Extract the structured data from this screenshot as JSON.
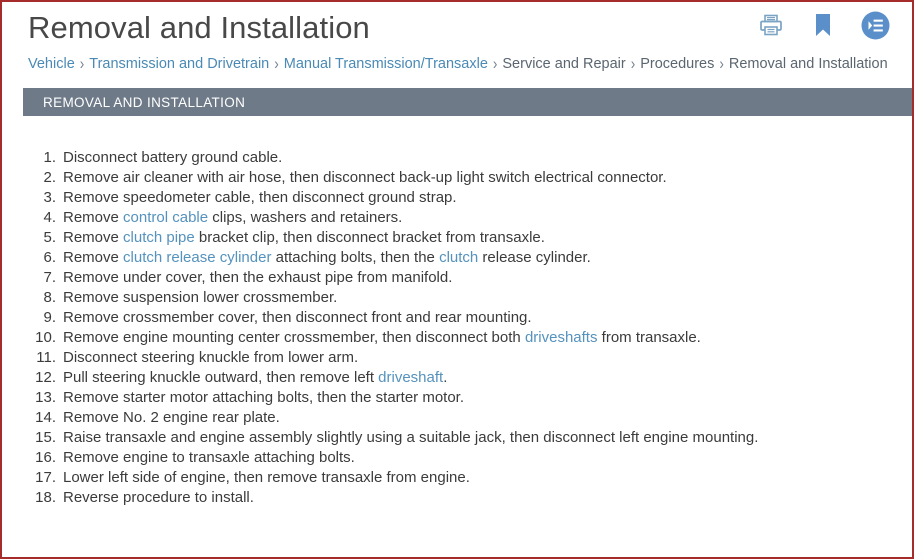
{
  "header": {
    "title": "Removal and Installation",
    "actions": [
      {
        "name": "print-icon",
        "label": "Print"
      },
      {
        "name": "bookmark-icon",
        "label": "Bookmark"
      },
      {
        "name": "table-of-contents-icon",
        "label": "Table of Contents"
      }
    ]
  },
  "breadcrumb": {
    "separator": "›",
    "items": [
      {
        "label": "Vehicle",
        "link": true
      },
      {
        "label": "Transmission and Drivetrain",
        "link": true
      },
      {
        "label": "Manual Transmission/Transaxle",
        "link": true
      },
      {
        "label": "Service and Repair",
        "link": false
      },
      {
        "label": "Procedures",
        "link": false
      },
      {
        "label": "Removal and Installation",
        "link": false
      }
    ]
  },
  "section": {
    "title": "REMOVAL AND INSTALLATION"
  },
  "procedure": {
    "steps": [
      {
        "num": "1.",
        "parts": [
          {
            "t": "Disconnect battery ground cable."
          }
        ]
      },
      {
        "num": "2.",
        "parts": [
          {
            "t": "Remove air cleaner with air hose, then disconnect back-up light switch electrical connector."
          }
        ]
      },
      {
        "num": "3.",
        "parts": [
          {
            "t": "Remove speedometer cable, then disconnect ground strap."
          }
        ]
      },
      {
        "num": "4.",
        "parts": [
          {
            "t": "Remove "
          },
          {
            "t": "control cable",
            "link": true
          },
          {
            "t": " clips, washers and retainers."
          }
        ]
      },
      {
        "num": "5.",
        "parts": [
          {
            "t": "Remove "
          },
          {
            "t": "clutch pipe",
            "link": true
          },
          {
            "t": " bracket clip, then disconnect bracket from transaxle."
          }
        ]
      },
      {
        "num": "6.",
        "parts": [
          {
            "t": "Remove "
          },
          {
            "t": "clutch release cylinder",
            "link": true
          },
          {
            "t": " attaching bolts, then the "
          },
          {
            "t": "clutch",
            "link": true
          },
          {
            "t": " release cylinder."
          }
        ]
      },
      {
        "num": "7.",
        "parts": [
          {
            "t": "Remove under cover, then the exhaust pipe from manifold."
          }
        ]
      },
      {
        "num": "8.",
        "parts": [
          {
            "t": "Remove suspension lower crossmember."
          }
        ]
      },
      {
        "num": "9.",
        "parts": [
          {
            "t": "Remove crossmember cover, then disconnect front and rear mounting."
          }
        ]
      },
      {
        "num": "10.",
        "parts": [
          {
            "t": "Remove engine mounting center crossmember, then disconnect both "
          },
          {
            "t": "driveshafts",
            "link": true
          },
          {
            "t": " from transaxle."
          }
        ]
      },
      {
        "num": "11.",
        "parts": [
          {
            "t": "Disconnect steering knuckle from lower arm."
          }
        ]
      },
      {
        "num": "12.",
        "parts": [
          {
            "t": "Pull steering knuckle outward, then remove left "
          },
          {
            "t": "driveshaft",
            "link": true
          },
          {
            "t": "."
          }
        ]
      },
      {
        "num": "13.",
        "parts": [
          {
            "t": "Remove starter motor attaching bolts, then the starter motor."
          }
        ]
      },
      {
        "num": "14.",
        "parts": [
          {
            "t": "Remove No. 2 engine rear plate."
          }
        ]
      },
      {
        "num": "15.",
        "parts": [
          {
            "t": "Raise transaxle and engine assembly slightly using a suitable jack, then disconnect left engine mounting."
          }
        ]
      },
      {
        "num": "16.",
        "parts": [
          {
            "t": "Remove engine to transaxle attaching bolts."
          }
        ]
      },
      {
        "num": "17.",
        "parts": [
          {
            "t": "Lower left side of engine, then remove transaxle from engine."
          }
        ]
      },
      {
        "num": "18.",
        "parts": [
          {
            "t": "Reverse procedure to install."
          }
        ]
      }
    ]
  },
  "colors": {
    "border_red": "#a62c2c",
    "section_bar": "#6e7a88",
    "link_blue": "#5592bd",
    "breadcrumb_link": "#4a8ab5",
    "icon_blue": "#6699cc",
    "text": "#3b3b3b"
  }
}
